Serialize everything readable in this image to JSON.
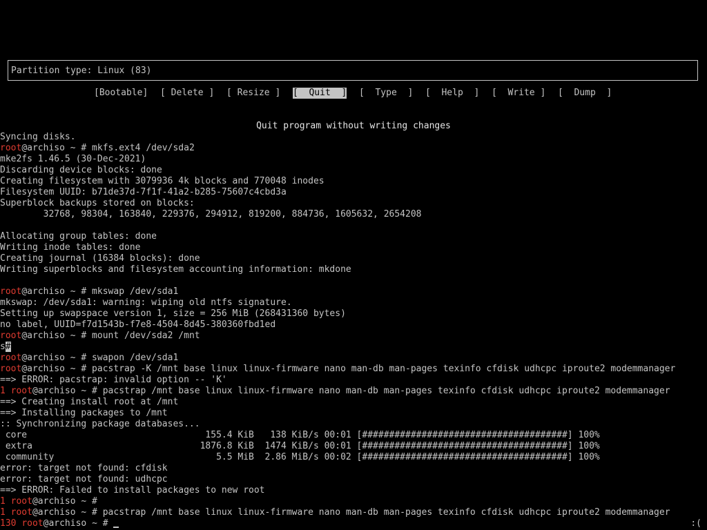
{
  "cfdisk": {
    "partition_type": "Partition type: Linux (83)",
    "menu": [
      {
        "label": "[Bootable]",
        "selected": false
      },
      {
        "label": "[ Delete ]",
        "selected": false
      },
      {
        "label": "[ Resize ]",
        "selected": false
      },
      {
        "label": "[  Quit  ]",
        "selected": true
      },
      {
        "label": "[  Type  ]",
        "selected": false
      },
      {
        "label": "[  Help  ]",
        "selected": false
      },
      {
        "label": "[  Write ]",
        "selected": false
      },
      {
        "label": "[  Dump  ]",
        "selected": false
      }
    ],
    "hint": "Quit program without writing changes"
  },
  "terminal": {
    "lines": [
      {
        "text": "Syncing disks."
      },
      {
        "exit": "",
        "user": "root",
        "rest": "@archiso ~ # mkfs.ext4 /dev/sda2"
      },
      {
        "text": "mke2fs 1.46.5 (30-Dec-2021)"
      },
      {
        "text": "Discarding device blocks: done"
      },
      {
        "text": "Creating filesystem with 3079936 4k blocks and 770048 inodes"
      },
      {
        "text": "Filesystem UUID: b71de37d-7f1f-41a2-b285-75607c4cbd3a"
      },
      {
        "text": "Superblock backups stored on blocks:"
      },
      {
        "text": "        32768, 98304, 163840, 229376, 294912, 819200, 884736, 1605632, 2654208"
      },
      {
        "text": ""
      },
      {
        "text": "Allocating group tables: done"
      },
      {
        "text": "Writing inode tables: done"
      },
      {
        "text": "Creating journal (16384 blocks): done"
      },
      {
        "text": "Writing superblocks and filesystem accounting information: mkdone"
      },
      {
        "text": ""
      },
      {
        "exit": "",
        "user": "root",
        "rest": "@archiso ~ # mkswap /dev/sda1"
      },
      {
        "text": "mkswap: /dev/sda1: warning: wiping old ntfs signature."
      },
      {
        "text": "Setting up swapspace version 1, size = 256 MiB (268431360 bytes)"
      },
      {
        "text": "no label, UUID=f7d1543b-f7e8-4504-8d45-380360fbd1ed"
      },
      {
        "exit": "",
        "user": "root",
        "rest": "@archiso ~ # mount /dev/sda2 /mnt"
      },
      {
        "text": "s",
        "cursor": "#"
      },
      {
        "exit": "",
        "user": "root",
        "rest": "@archiso ~ # swapon /dev/sda1"
      },
      {
        "exit": "",
        "user": "root",
        "rest": "@archiso ~ # pacstrap -K /mnt base linux linux-firmware nano man-db man-pages texinfo cfdisk udhcpc iproute2 modemmanager"
      },
      {
        "text": "==> ERROR: pacstrap: invalid option -- 'K'"
      },
      {
        "exit": "1 ",
        "user": "root",
        "rest": "@archiso ~ # pacstrap /mnt base linux linux-firmware nano man-db man-pages texinfo cfdisk udhcpc iproute2 modemmanager"
      },
      {
        "text": "==> Creating install root at /mnt"
      },
      {
        "text": "==> Installing packages to /mnt"
      },
      {
        "text": ":: Synchronizing package databases..."
      },
      {
        "text": " core                                 155.4 KiB   138 KiB/s 00:01 [######################################] 100%"
      },
      {
        "text": " extra                               1876.8 KiB  1474 KiB/s 00:01 [######################################] 100%"
      },
      {
        "text": " community                              5.5 MiB  2.86 MiB/s 00:02 [######################################] 100%"
      },
      {
        "text": "error: target not found: cfdisk"
      },
      {
        "text": "error: target not found: udhcpc"
      },
      {
        "text": "==> ERROR: Failed to install packages to new root"
      },
      {
        "exit": "1 ",
        "user": "root",
        "rest": "@archiso ~ #"
      },
      {
        "exit": "1 ",
        "user": "root",
        "rest": "@archiso ~ # pacstrap /mnt base linux linux-firmware nano man-db man-pages texinfo cfdisk udhcpc iproute2 modemmanager"
      },
      {
        "exit": "130 ",
        "user": "root",
        "rest": "@archiso ~ # ",
        "ucursor": true
      }
    ],
    "status_right": ":("
  }
}
